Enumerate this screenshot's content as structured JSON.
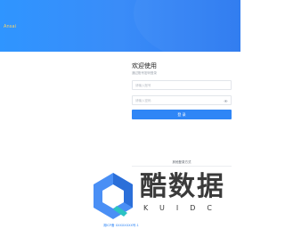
{
  "hero": {
    "brand": "Ansai",
    "background_from": "#2f95ff",
    "background_to": "#2a78f0"
  },
  "login": {
    "title": "欢迎使用",
    "subtitle": "通过账号密码登录",
    "phone_placeholder": "请输入账号",
    "password_placeholder": "请输入密码",
    "submit_label": "登 录",
    "eye_icon": "eye-icon"
  },
  "other": {
    "label": "其他登录方式"
  },
  "footer": {
    "link": "湘ICP备 XXXXXXXX号-1"
  },
  "watermark": {
    "text": "酷数据",
    "sub": "KUIDC"
  },
  "colors": {
    "accent": "#2f86f6",
    "brand_text": "#f5d36a"
  }
}
